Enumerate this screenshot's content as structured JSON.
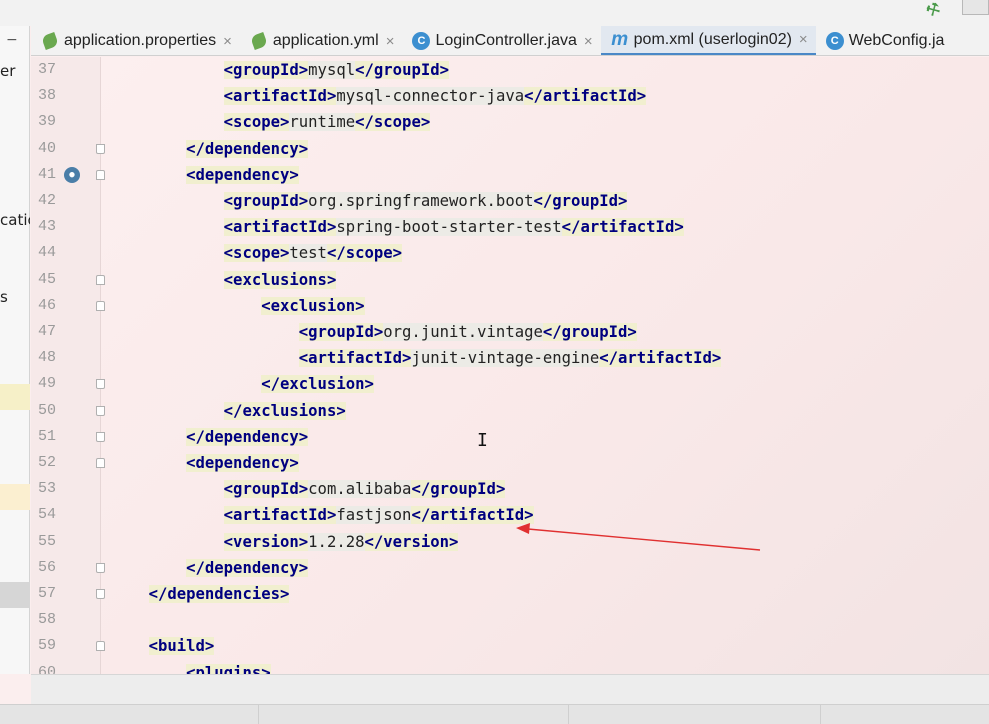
{
  "tabs": [
    {
      "label": "application.properties",
      "icon": "spring-leaf-icon",
      "closable": true
    },
    {
      "label": "application.yml",
      "icon": "spring-leaf-icon",
      "closable": true
    },
    {
      "label": "LoginController.java",
      "icon": "java-class-icon",
      "closable": true
    },
    {
      "label": "pom.xml (userlogin02)",
      "icon": "maven-icon",
      "closable": true,
      "active": true
    },
    {
      "label": "WebConfig.ja",
      "icon": "java-class-icon",
      "closable": false
    }
  ],
  "left_panel_fragments": [
    "er",
    "catic",
    "s"
  ],
  "icons": {
    "collapse": "−",
    "close": "×",
    "class": "C",
    "maven": "m",
    "caret": "I"
  },
  "colors": {
    "tag": "#000080",
    "arrow": "#e03030",
    "active_tab_underline": "#4a88c7"
  },
  "lines": [
    {
      "n": "37",
      "code": [
        [
          "",
          "            "
        ],
        [
          "t",
          "<groupId>"
        ],
        [
          "x",
          "mysql"
        ],
        [
          "t",
          "</groupId>"
        ]
      ]
    },
    {
      "n": "38",
      "code": [
        [
          "",
          "            "
        ],
        [
          "t",
          "<artifactId>"
        ],
        [
          "x",
          "mysql-connector-java"
        ],
        [
          "t",
          "</artifactId>"
        ]
      ]
    },
    {
      "n": "39",
      "code": [
        [
          "",
          "            "
        ],
        [
          "t",
          "<scope>"
        ],
        [
          "x",
          "runtime"
        ],
        [
          "t",
          "</scope>"
        ]
      ]
    },
    {
      "n": "40",
      "fold": "close",
      "code": [
        [
          "",
          "        "
        ],
        [
          "t",
          "</dependency>"
        ]
      ]
    },
    {
      "n": "41",
      "fold": "open",
      "marker": true,
      "code": [
        [
          "",
          "        "
        ],
        [
          "t",
          "<dependency>"
        ]
      ]
    },
    {
      "n": "42",
      "code": [
        [
          "",
          "            "
        ],
        [
          "t",
          "<groupId>"
        ],
        [
          "x",
          "org.springframework.boot"
        ],
        [
          "t",
          "</groupId>"
        ]
      ]
    },
    {
      "n": "43",
      "code": [
        [
          "",
          "            "
        ],
        [
          "t",
          "<artifactId>"
        ],
        [
          "x",
          "spring-boot-starter-test"
        ],
        [
          "t",
          "</artifactId>"
        ]
      ]
    },
    {
      "n": "44",
      "code": [
        [
          "",
          "            "
        ],
        [
          "t",
          "<scope>"
        ],
        [
          "x",
          "test"
        ],
        [
          "t",
          "</scope>"
        ]
      ]
    },
    {
      "n": "45",
      "fold": "open",
      "code": [
        [
          "",
          "            "
        ],
        [
          "t",
          "<exclusions>"
        ]
      ]
    },
    {
      "n": "46",
      "fold": "open",
      "code": [
        [
          "",
          "                "
        ],
        [
          "t",
          "<exclusion>"
        ]
      ]
    },
    {
      "n": "47",
      "code": [
        [
          "",
          "                    "
        ],
        [
          "t",
          "<groupId>"
        ],
        [
          "x",
          "org.junit.vintage"
        ],
        [
          "t",
          "</groupId>"
        ]
      ]
    },
    {
      "n": "48",
      "code": [
        [
          "",
          "                    "
        ],
        [
          "t",
          "<artifactId>"
        ],
        [
          "x",
          "junit-vintage-engine"
        ],
        [
          "t",
          "</artifactId>"
        ]
      ]
    },
    {
      "n": "49",
      "fold": "close",
      "code": [
        [
          "",
          "                "
        ],
        [
          "t",
          "</exclusion>"
        ]
      ]
    },
    {
      "n": "50",
      "fold": "close",
      "code": [
        [
          "",
          "            "
        ],
        [
          "t",
          "</exclusions>"
        ]
      ]
    },
    {
      "n": "51",
      "fold": "close",
      "code": [
        [
          "",
          "        "
        ],
        [
          "t",
          "</dependency>"
        ]
      ]
    },
    {
      "n": "52",
      "fold": "open",
      "code": [
        [
          "",
          "        "
        ],
        [
          "t",
          "<dependency>"
        ]
      ]
    },
    {
      "n": "53",
      "code": [
        [
          "",
          "            "
        ],
        [
          "t",
          "<groupId>"
        ],
        [
          "x",
          "com.alibaba"
        ],
        [
          "t",
          "</groupId>"
        ]
      ]
    },
    {
      "n": "54",
      "code": [
        [
          "",
          "            "
        ],
        [
          "t",
          "<artifactId>"
        ],
        [
          "x",
          "fastjson"
        ],
        [
          "t",
          "</artifactId>"
        ]
      ]
    },
    {
      "n": "55",
      "code": [
        [
          "",
          "            "
        ],
        [
          "t",
          "<version>"
        ],
        [
          "x",
          "1.2.28"
        ],
        [
          "t",
          "</version>"
        ]
      ]
    },
    {
      "n": "56",
      "fold": "close",
      "code": [
        [
          "",
          "        "
        ],
        [
          "t",
          "</dependency>"
        ]
      ]
    },
    {
      "n": "57",
      "fold": "close",
      "code": [
        [
          "",
          "    "
        ],
        [
          "t",
          "</dependencies>"
        ]
      ]
    },
    {
      "n": "58",
      "code": []
    },
    {
      "n": "59",
      "fold": "open",
      "code": [
        [
          "",
          "    "
        ],
        [
          "t",
          "<build>"
        ]
      ]
    },
    {
      "n": "60",
      "code": [
        [
          "",
          "        "
        ],
        [
          "t",
          "<plugins>"
        ]
      ]
    }
  ]
}
